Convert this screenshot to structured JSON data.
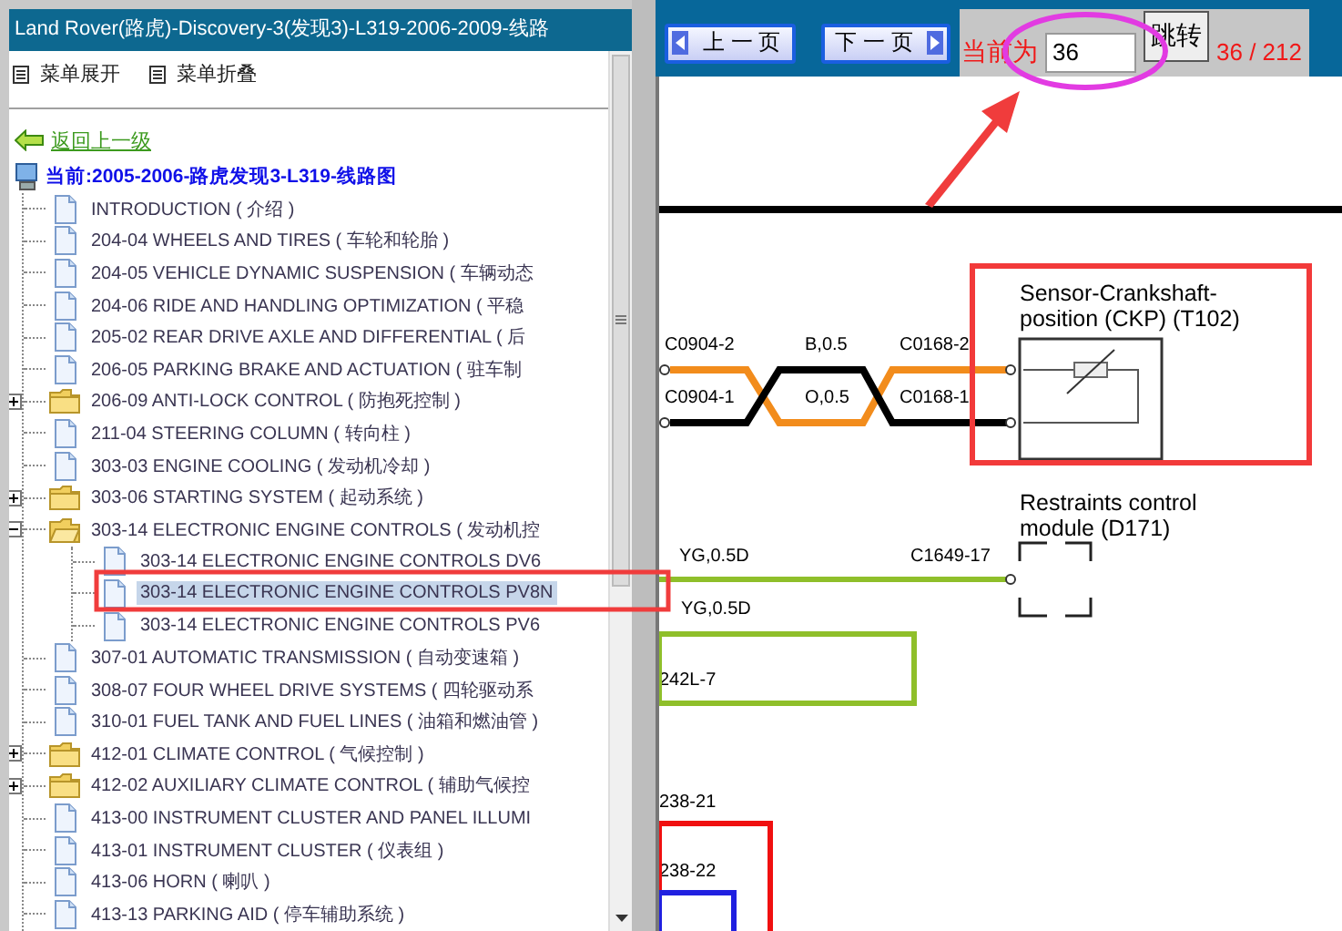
{
  "sidebar": {
    "title": "Land Rover(路虎)-Discovery-3(发现3)-L319-2006-2009-线路",
    "menu": [
      {
        "label": "菜单展开"
      },
      {
        "label": "菜单折叠"
      }
    ],
    "back_link": "返回上一级",
    "current": "当前:2005-2006-路虎发现3-L319-线路图",
    "items": [
      {
        "kind": "doc",
        "label": "INTRODUCTION ( 介绍 )",
        "selected": false
      },
      {
        "kind": "doc",
        "label": "204-04 WHEELS AND TIRES ( 车轮和轮胎 )",
        "selected": false
      },
      {
        "kind": "doc",
        "label": "204-05 VEHICLE DYNAMIC SUSPENSION ( 车辆动态",
        "selected": false
      },
      {
        "kind": "doc",
        "label": "204-06 RIDE AND HANDLING OPTIMIZATION ( 平稳",
        "selected": false
      },
      {
        "kind": "doc",
        "label": "205-02 REAR DRIVE AXLE AND DIFFERENTIAL ( 后",
        "selected": false
      },
      {
        "kind": "doc",
        "label": "206-05 PARKING BRAKE AND ACTUATION ( 驻车制",
        "selected": false
      },
      {
        "kind": "folder",
        "label": "206-09 ANTI-LOCK CONTROL ( 防抱死控制 )",
        "expanded": false,
        "selected": false
      },
      {
        "kind": "doc",
        "label": "211-04 STEERING COLUMN ( 转向柱 )",
        "selected": false
      },
      {
        "kind": "doc",
        "label": "303-03 ENGINE COOLING ( 发动机冷却 )",
        "selected": false
      },
      {
        "kind": "folder",
        "label": "303-06 STARTING SYSTEM ( 起动系统 )",
        "expanded": false,
        "selected": false
      },
      {
        "kind": "folder",
        "label": "303-14 ELECTRONIC ENGINE CONTROLS ( 发动机控",
        "expanded": true,
        "selected": false,
        "children": [
          {
            "kind": "doc",
            "label": "303-14 ELECTRONIC ENGINE CONTROLS DV6",
            "selected": false
          },
          {
            "kind": "doc",
            "label": "303-14 ELECTRONIC ENGINE CONTROLS PV8N",
            "selected": true
          },
          {
            "kind": "doc",
            "label": "303-14 ELECTRONIC ENGINE CONTROLS PV6",
            "selected": false
          }
        ]
      },
      {
        "kind": "doc",
        "label": "307-01 AUTOMATIC TRANSMISSION ( 自动变速箱 )",
        "selected": false
      },
      {
        "kind": "doc",
        "label": "308-07 FOUR WHEEL DRIVE SYSTEMS ( 四轮驱动系",
        "selected": false
      },
      {
        "kind": "doc",
        "label": "310-01 FUEL TANK AND FUEL LINES ( 油箱和燃油管 )",
        "selected": false
      },
      {
        "kind": "folder",
        "label": "412-01 CLIMATE CONTROL ( 气候控制 )",
        "expanded": false,
        "selected": false
      },
      {
        "kind": "folder",
        "label": "412-02 AUXILIARY CLIMATE CONTROL ( 辅助气候控",
        "expanded": false,
        "selected": false
      },
      {
        "kind": "doc",
        "label": "413-00 INSTRUMENT CLUSTER AND PANEL ILLUMI",
        "selected": false
      },
      {
        "kind": "doc",
        "label": "413-01 INSTRUMENT CLUSTER ( 仪表组 )",
        "selected": false
      },
      {
        "kind": "doc",
        "label": "413-06 HORN ( 喇叭 )",
        "selected": false
      },
      {
        "kind": "doc",
        "label": "413-13 PARKING AID ( 停车辅助系统 )",
        "selected": false
      }
    ]
  },
  "toolbar": {
    "prev_button": "上 一 页",
    "next_button": "下 一 页",
    "page_label": "当前为",
    "page_input": "36",
    "go_button": "跳转",
    "page_count": "36 / 212"
  },
  "diagram": {
    "components": [
      {
        "kind": "sensor",
        "label_lines": [
          "Sensor-Crankshaft-",
          "position (CKP) (T102)"
        ]
      },
      {
        "kind": "module",
        "label_lines": [
          "Restraints control",
          "module (D171)"
        ]
      }
    ],
    "wire_labels": [
      "C0904-2",
      "B,0.5",
      "C0168-2",
      "C0904-1",
      "O,0.5",
      "C0168-1",
      "YG,0.5D",
      "C1649-17",
      "YG,0.5D",
      "242L-7",
      "238-21",
      "238-22"
    ]
  }
}
